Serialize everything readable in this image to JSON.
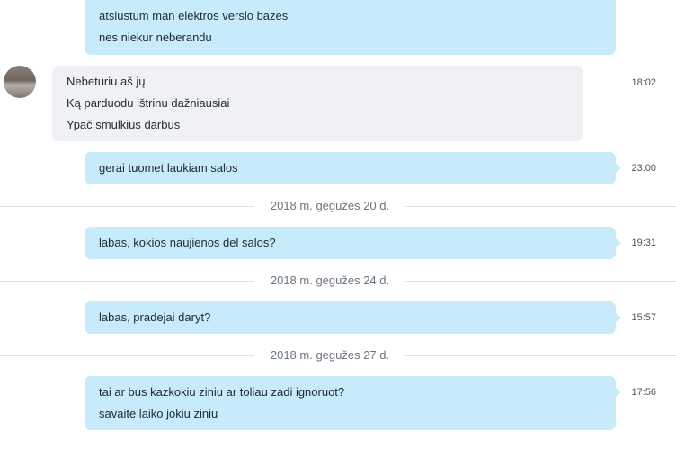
{
  "colors": {
    "outgoing_bubble": "#c7ebfa",
    "incoming_bubble": "#eff1f5",
    "divider_text": "#6b7580"
  },
  "messages": [
    {
      "direction": "outgoing",
      "lines": [
        "atsiustum man elektros verslo bazes",
        "nes niekur neberandu"
      ],
      "time": ""
    },
    {
      "direction": "incoming",
      "lines": [
        "Nebeturiu aš jų",
        "Ką parduodu ištrinu dažniausiai",
        "Ypač smulkius darbus"
      ],
      "time": "18:02"
    },
    {
      "direction": "outgoing",
      "lines": [
        "gerai tuomet laukiam salos"
      ],
      "time": "23:00"
    },
    {
      "direction": "outgoing",
      "lines": [
        "labas, kokios naujienos del salos?"
      ],
      "time": "19:31"
    },
    {
      "direction": "outgoing",
      "lines": [
        "labas, pradejai daryt?"
      ],
      "time": "15:57"
    },
    {
      "direction": "outgoing",
      "lines": [
        "tai ar bus kazkokiu ziniu ar toliau zadi ignoruot?",
        "savaite laiko jokiu ziniu"
      ],
      "time": "17:56"
    }
  ],
  "date_dividers": [
    "2018 m. gegužės 20 d.",
    "2018 m. gegužės 24 d.",
    "2018 m. gegužės 27 d."
  ]
}
